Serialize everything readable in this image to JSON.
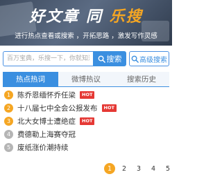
{
  "banner": {
    "title_part1": "好文章",
    "title_part2": "同",
    "title_part3": "乐搜",
    "subtitle": "进行热点查看或搜索 ，开拓思路 ，激发写作灵感"
  },
  "search": {
    "placeholder": "百万宝典，乐搜一下，你就知道",
    "button_label": "搜索",
    "button_icon": "search-icon",
    "advanced_label": "高级搜索",
    "advanced_icon": "search-icon",
    "accent_color": "#3b8fe0"
  },
  "tabs": [
    {
      "label": "热点热词",
      "active": true
    },
    {
      "label": "微博热议",
      "active": false
    },
    {
      "label": "搜索历史",
      "active": false
    }
  ],
  "hot_list": [
    {
      "rank": "1",
      "text": "陈乔恩缅怀乔任梁",
      "badge": "HOT"
    },
    {
      "rank": "2",
      "text": "十八届七中全会公报发布",
      "badge": "HOT"
    },
    {
      "rank": "3",
      "text": "北大女博士遭绝症",
      "badge": "HOT"
    },
    {
      "rank": "4",
      "text": "费德勒上海赛夺冠",
      "badge": ""
    },
    {
      "rank": "5",
      "text": "废纸涨价潮持续",
      "badge": ""
    }
  ],
  "pagination": {
    "pages": [
      "1",
      "2",
      "3",
      "4",
      "5"
    ],
    "current": "1",
    "highlight_color": "#f5a623"
  }
}
